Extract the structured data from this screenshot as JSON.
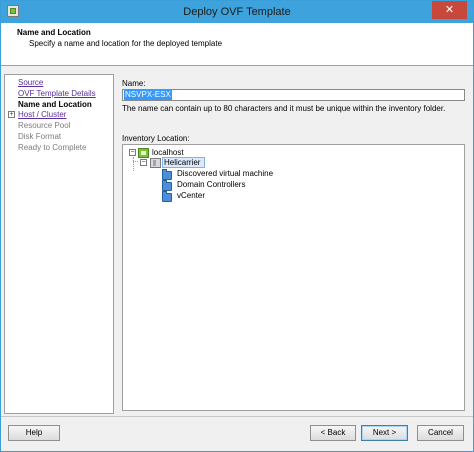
{
  "window": {
    "title": "Deploy OVF Template",
    "close_glyph": "✕"
  },
  "header": {
    "title": "Name and Location",
    "subtitle": "Specify a name and location for the deployed template"
  },
  "steps": [
    {
      "label": "Source",
      "state": "link"
    },
    {
      "label": "OVF Template Details",
      "state": "link"
    },
    {
      "label": "Name and Location",
      "state": "current"
    },
    {
      "label": "Host / Cluster",
      "state": "link",
      "expandable": true,
      "expander_glyph": "+"
    },
    {
      "label": "Resource Pool",
      "state": "disabled"
    },
    {
      "label": "Disk Format",
      "state": "disabled"
    },
    {
      "label": "Ready to Complete",
      "state": "disabled"
    }
  ],
  "name_field": {
    "label": "Name:",
    "value": "NSVPX-ESX",
    "hint": "The name can contain up to 80 characters and it must be unique within the inventory folder."
  },
  "inventory": {
    "label": "Inventory Location:",
    "root": {
      "label": "localhost",
      "icon": "host-icon",
      "expander": "−"
    },
    "datacenter": {
      "label": "Helicarrier",
      "icon": "datacenter-icon",
      "expander": "−",
      "selected": true
    },
    "folders": [
      {
        "label": "Discovered virtual machine",
        "icon": "folder-icon"
      },
      {
        "label": "Domain Controllers",
        "icon": "folder-icon"
      },
      {
        "label": "vCenter",
        "icon": "folder-icon"
      }
    ]
  },
  "buttons": {
    "help": "Help",
    "back": "< Back",
    "next": "Next >",
    "cancel": "Cancel"
  },
  "colors": {
    "titlebar": "#3ea3dd",
    "close": "#c7493b",
    "link": "#5b2ea0",
    "selection": "#3399ff"
  }
}
